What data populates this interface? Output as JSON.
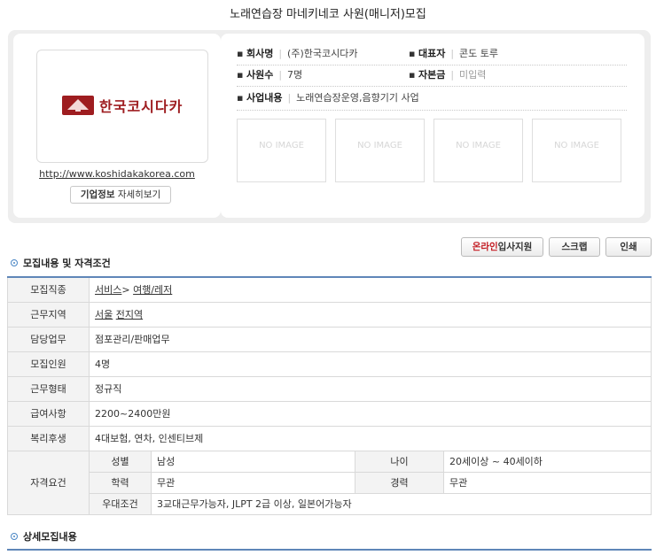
{
  "title": "노래연습장 마네키네코 사원(매니저)모집",
  "company": {
    "logo_text": "한국코시다카",
    "homepage": "http://www.koshidakakorea.com",
    "detail_button": {
      "bold": "기업정보",
      "rest": " 자세히보기"
    },
    "fields": {
      "company_name_label": "회사명",
      "company_name": "(주)한국코시다카",
      "ceo_label": "대표자",
      "ceo": "콘도 토루",
      "employees_label": "사원수",
      "employees": "7명",
      "capital_label": "자본금",
      "capital": "미입력",
      "business_label": "사업내용",
      "business": "노래연습장운영,음향기기 사업"
    },
    "no_image": [
      "NO IMAGE",
      "NO IMAGE",
      "NO IMAGE",
      "NO IMAGE"
    ]
  },
  "actions": {
    "apply_accent": "온라인",
    "apply_rest": "입사지원",
    "scrap": "스크랩",
    "print": "인쇄"
  },
  "sections": {
    "requirements_title": "모집내용 및 자격조건",
    "details_title": "상세모집내용"
  },
  "table": {
    "job_type_label": "모집직종",
    "job_type_cat": "서비스",
    "job_type_sep": ">",
    "job_type_sub": "여행/레저",
    "location_label": "근무지역",
    "location_city": "서울",
    "location_area": "전지역",
    "duty_label": "담당업무",
    "duty": "점포관리/판매업무",
    "headcount_label": "모집인원",
    "headcount": "4명",
    "employment_label": "근무형태",
    "employment": "정규직",
    "salary_label": "급여사항",
    "salary": "2200~2400만원",
    "welfare_label": "복리후생",
    "welfare": "4대보험, 연차, 인센티브제",
    "qualification_label": "자격요건",
    "gender_label": "성별",
    "gender": "남성",
    "age_label": "나이",
    "age": "20세이상 ~ 40세이하",
    "education_label": "학력",
    "education": "무관",
    "career_label": "경력",
    "career": "무관",
    "preference_label": "우대조건",
    "preference": "3교대근무가능자, JLPT 2급 이상, 일본어가능자"
  }
}
